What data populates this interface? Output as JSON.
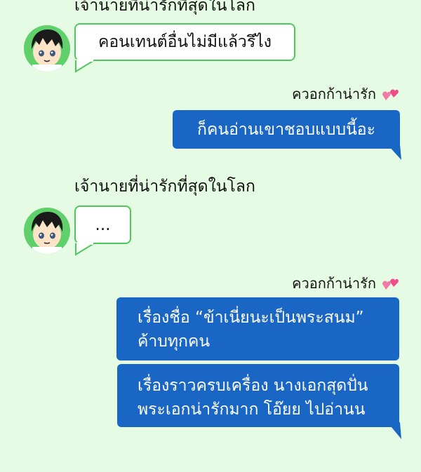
{
  "messages": [
    {
      "sender": "เจ้านายที่น่ารักที่สุดในโลก",
      "text": "คอนเทนต์อื่นไม่มีแล้วรึไง"
    },
    {
      "sender": "ควอกก้าน่ารัก",
      "text": "ก็คนอ่านเขาชอบแบบนี้อะ"
    },
    {
      "sender": "เจ้านายที่น่ารักที่สุดในโลก",
      "text": "..."
    },
    {
      "sender": "ควอกก้าน่ารัก",
      "line1": "เรื่องชื่อ “ข้าเนี่ยนะเป็นพระสนม”",
      "line2": "ค้าบทุกคน",
      "line3": "เรื่องราวครบเครื่อง นางเอกสุดปั่น",
      "line4": "พระเอกน่ารักมาก โอ๊ยย ไปอ่านน"
    }
  ],
  "colors": {
    "background": "#e6fbe4",
    "accent_green": "#4cc95a",
    "bubble_blue": "#1a66c4",
    "heart_pink": "#ee4d8a"
  },
  "icons": {
    "avatar": "boy-avatar-icon",
    "heart": "two-hearts-icon"
  }
}
